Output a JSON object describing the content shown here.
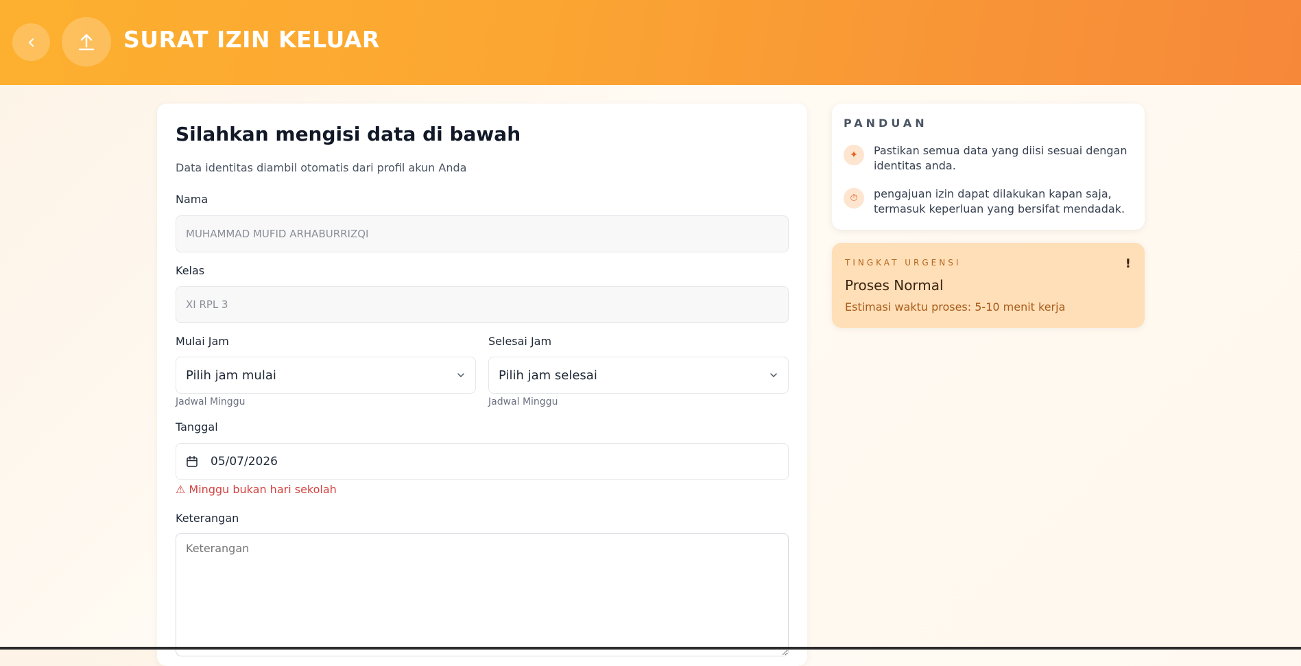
{
  "header": {
    "title": "SURAT IZIN KELUAR",
    "back_icon": "chevron-left-icon",
    "upload_icon": "upload-icon"
  },
  "form": {
    "title": "Silahkan mengisi data di bawah",
    "subtitle": "Data identitas diambil otomatis dari profil akun Anda",
    "nama": {
      "label": "Nama",
      "value": "MUHAMMAD MUFID ARHABURRIZQI"
    },
    "kelas": {
      "label": "Kelas",
      "value": "XI RPL 3"
    },
    "mulai": {
      "label": "Mulai Jam",
      "value": "Pilih jam mulai",
      "hint": "Jadwal Minggu"
    },
    "selesai": {
      "label": "Selesai Jam",
      "value": "Pilih jam selesai",
      "hint": "Jadwal Minggu"
    },
    "tanggal": {
      "label": "Tanggal",
      "value": "05/07/2026",
      "error": "⚠ Minggu bukan hari sekolah"
    },
    "keterangan": {
      "label": "Keterangan",
      "placeholder": "Keterangan"
    }
  },
  "guide": {
    "heading": "PANDUAN",
    "items": [
      {
        "icon": "sparkle-icon",
        "text": "Pastikan semua data yang diisi sesuai dengan identitas anda."
      },
      {
        "icon": "stopwatch-icon",
        "text": "pengajuan izin dapat dilakukan kapan saja, termasuk keperluan yang bersifat mendadak."
      }
    ]
  },
  "urgency": {
    "heading": "TINGKAT URGENSI",
    "mark": "!",
    "title": "Proses Normal",
    "description": "Estimasi waktu proses: 5-10 menit kerja"
  },
  "colors": {
    "header_start": "#fdb02f",
    "header_end": "#f6883a",
    "urgency_bg": "#ffdfb8",
    "error": "#d1423f"
  }
}
